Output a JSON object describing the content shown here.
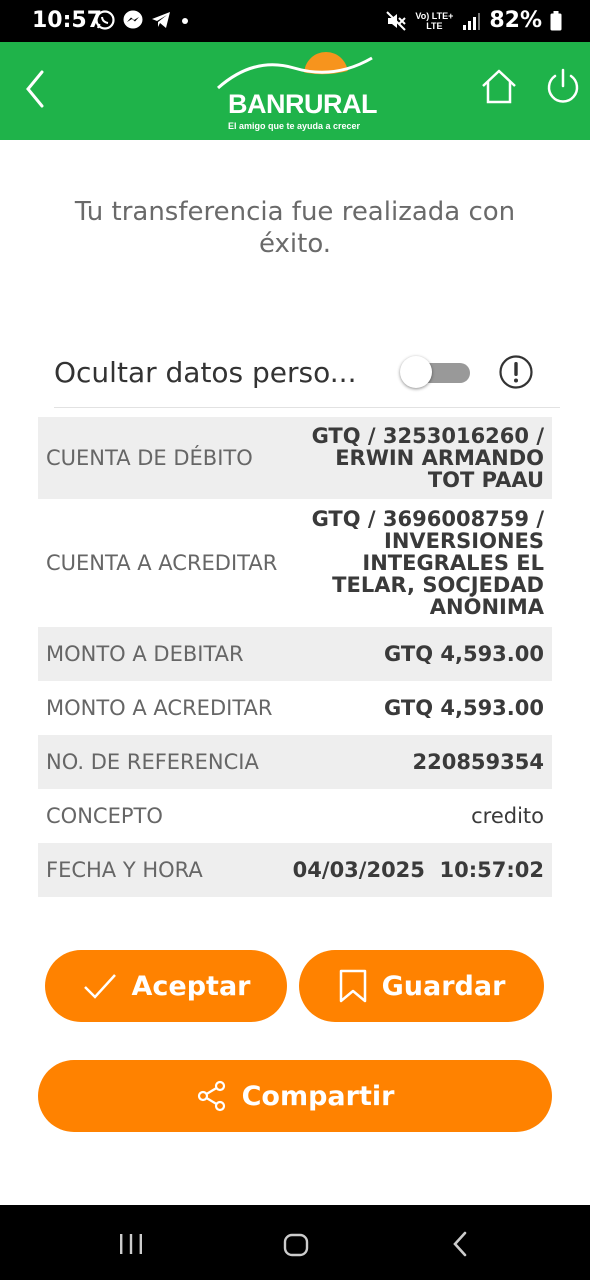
{
  "status_bar": {
    "time": "10:57",
    "network_top": "Vo) LTE+",
    "network_bottom": "LTE",
    "battery": "82%"
  },
  "header": {
    "logo_name": "BANRURAL",
    "logo_slogan": "El amigo que te ayuda a crecer"
  },
  "message": "Tu transferencia fue realizada con éxito.",
  "privacy": {
    "label": "Ocultar datos perso...",
    "toggle_on": false
  },
  "details": [
    {
      "label": "CUENTA DE DÉBITO",
      "value": "GTQ / 3253016260 /\nERWIN ARMANDO\nTOT PAAU"
    },
    {
      "label": "CUENTA A ACREDITAR",
      "value": "GTQ / 3696008759 /\nINVERSIONES\nINTEGRALES EL\nTELAR, SOCJEDAD\nANÓNIMA"
    },
    {
      "label": "MONTO A DEBITAR",
      "value": "GTQ 4,593.00"
    },
    {
      "label": "MONTO A ACREDITAR",
      "value": "GTQ 4,593.00"
    },
    {
      "label": "NO. DE REFERENCIA",
      "value": "220859354"
    },
    {
      "label": "CONCEPTO",
      "value": "credito"
    },
    {
      "label": "FECHA Y HORA",
      "value": "04/03/2025  10:57:02"
    }
  ],
  "buttons": {
    "accept": "Aceptar",
    "save": "Guardar",
    "share": "Compartir"
  },
  "colors": {
    "header_green": "#1fb34a",
    "button_orange": "#ff8200",
    "row_shade": "#eeeeee"
  }
}
